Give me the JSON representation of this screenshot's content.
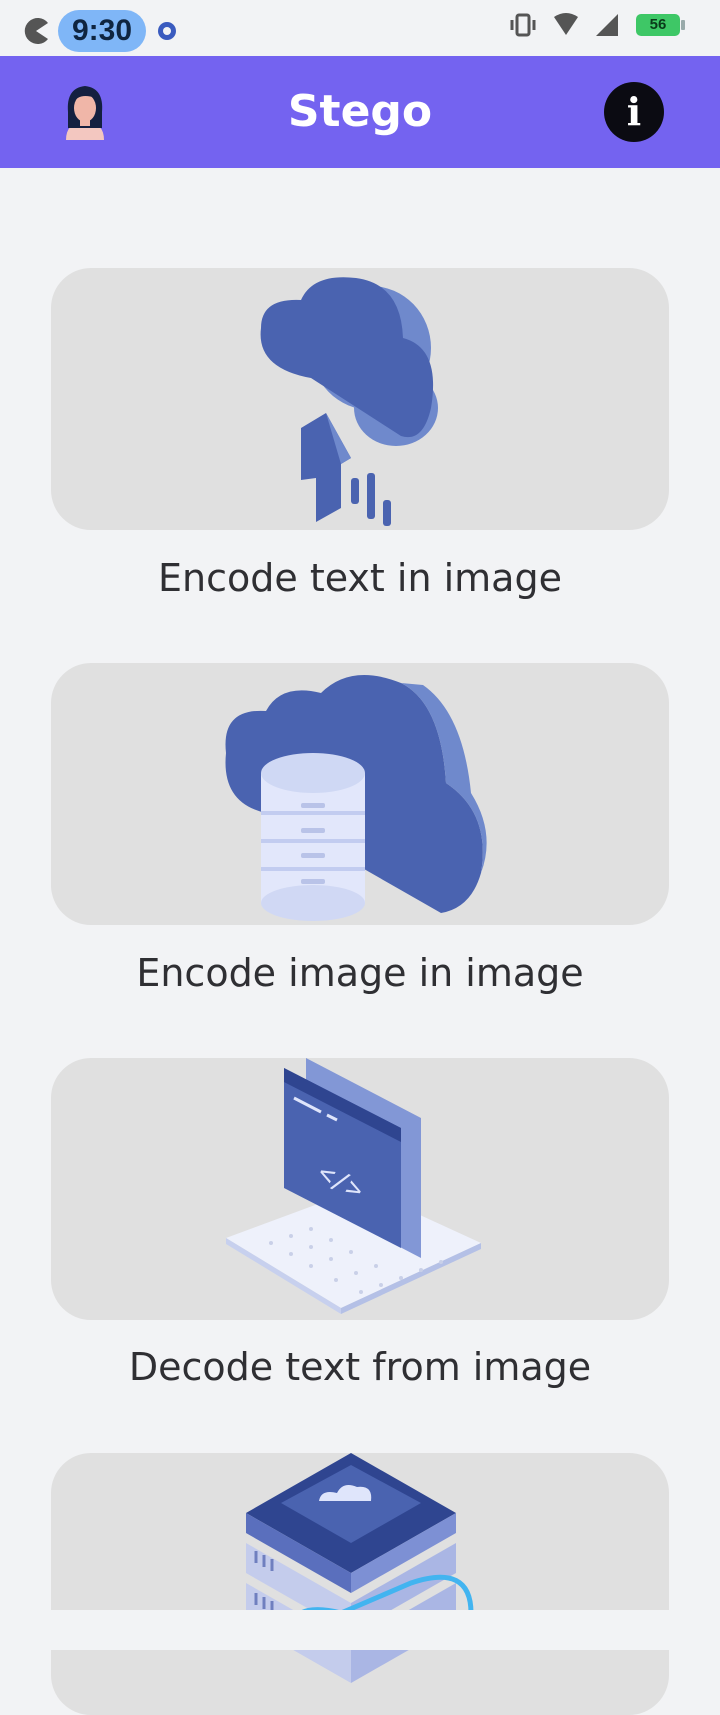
{
  "status_bar": {
    "time": "9:30",
    "battery": "56",
    "icons": [
      "pacman-icon",
      "settings-gear-icon",
      "vibrate-icon",
      "wifi-icon",
      "signal-icon",
      "battery-charging-icon"
    ]
  },
  "app_bar": {
    "title": "Stego",
    "avatar_icon": "woman-avatar-icon",
    "info_icon": "info-icon",
    "info_glyph": "i",
    "background": "#7463f0"
  },
  "options": [
    {
      "label": "Encode text in image",
      "icon": "cloud-upload-illustration"
    },
    {
      "label": "Encode image in image",
      "icon": "cloud-database-illustration"
    },
    {
      "label": "Decode text from image",
      "icon": "code-window-keyboard-illustration"
    },
    {
      "label": "",
      "icon": "server-cloud-illustration"
    }
  ],
  "colors": {
    "accent": "#7463f0",
    "card": "#e0e0e0",
    "illustration_blue": "#4a63b0"
  }
}
